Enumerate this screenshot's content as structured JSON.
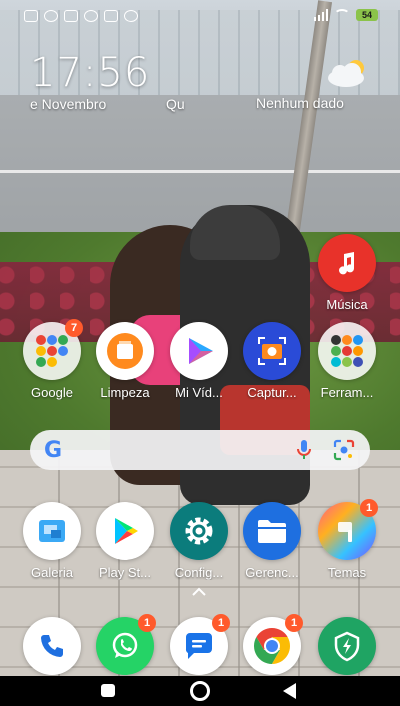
{
  "status_bar": {
    "battery": "54"
  },
  "widget": {
    "time": "17:56",
    "date_left": "e Novembro",
    "date_right": "Qu",
    "weather_text": "Nenhum dado"
  },
  "apps_row1": [
    {
      "label": "Música"
    }
  ],
  "apps_row2": [
    {
      "label": "Google",
      "badge": "7"
    },
    {
      "label": "Limpeza"
    },
    {
      "label": "Mi Víd..."
    },
    {
      "label": "Captur..."
    },
    {
      "label": "Ferram..."
    }
  ],
  "apps_row3": [
    {
      "label": "Galeria"
    },
    {
      "label": "Play St..."
    },
    {
      "label": "Config..."
    },
    {
      "label": "Gerenc..."
    },
    {
      "label": "Temas",
      "badge": "1"
    }
  ],
  "dock": [
    {
      "name": "phone"
    },
    {
      "name": "whatsapp",
      "badge": "1"
    },
    {
      "name": "messages",
      "badge": "1"
    },
    {
      "name": "chrome",
      "badge": "1"
    },
    {
      "name": "security"
    }
  ],
  "search": {
    "logo": "G"
  },
  "colors": {
    "badge": "#ff5a2c",
    "musica": "#e8322a",
    "limpeza": "#ff8a1e",
    "captura": "#2a4bd7",
    "config": "#0b7c7c",
    "gerenc": "#1e6fe0",
    "whatsapp": "#25d366",
    "security": "#1fa463"
  }
}
